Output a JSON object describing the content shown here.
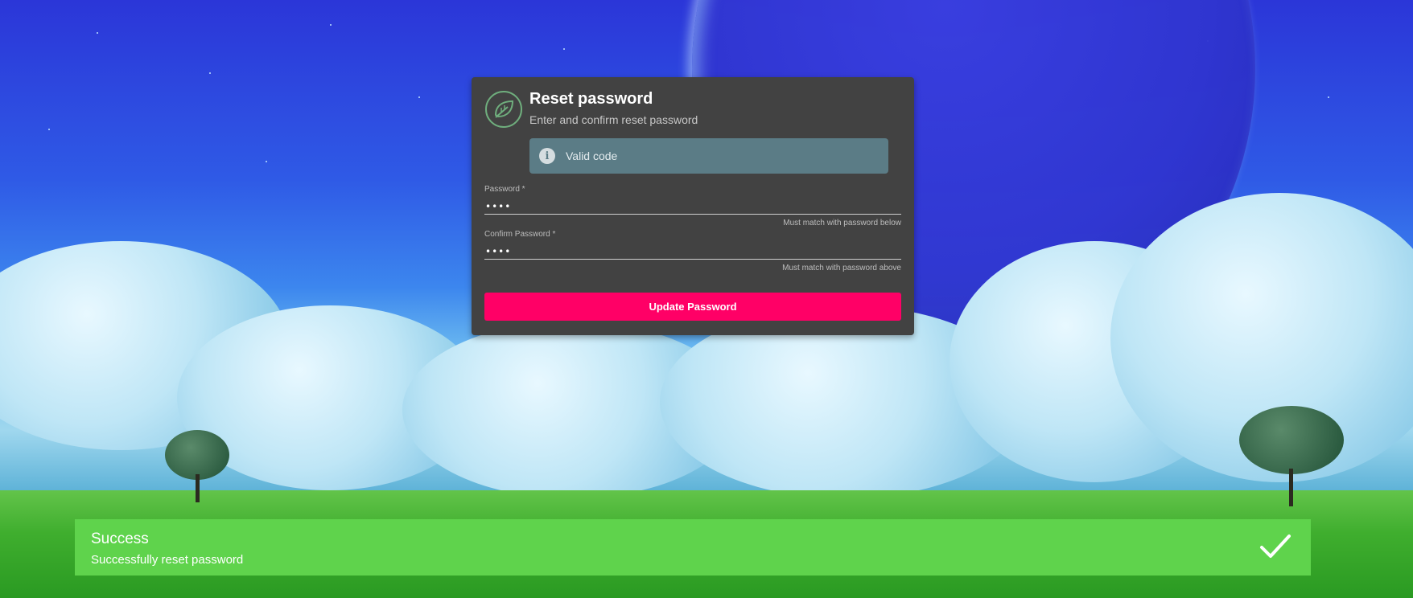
{
  "colors": {
    "card_bg": "#424242",
    "primary_button": "#ff0066",
    "info_alert": "#5b7c86",
    "success_toast": "#5fd34c"
  },
  "background": {
    "icon": "landscape-planet-wallpaper"
  },
  "card": {
    "logo_icon": "leaf-logo-icon",
    "title": "Reset password",
    "subtitle": "Enter and confirm reset password",
    "alert": {
      "icon": "info-icon",
      "text": "Valid code"
    },
    "password": {
      "label": "Password *",
      "value": "1234",
      "hint": "Must match with password below"
    },
    "confirm_password": {
      "label": "Confirm Password *",
      "value": "1234",
      "hint": "Must match with password above"
    },
    "submit_label": "Update Password"
  },
  "toast": {
    "title": "Success",
    "message": "Successfully reset password",
    "icon": "checkmark-icon"
  }
}
